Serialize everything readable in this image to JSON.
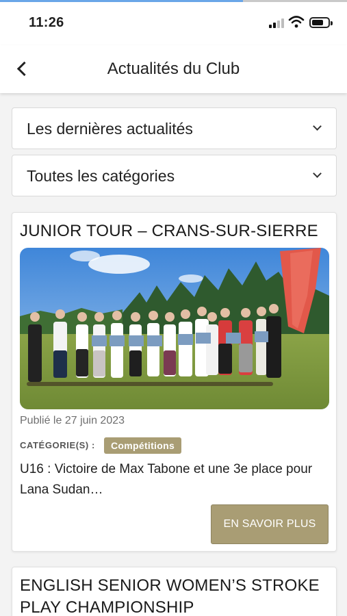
{
  "status_bar": {
    "time": "11:26",
    "icons": [
      "cellular-signal-icon",
      "wifi-icon",
      "battery-icon"
    ]
  },
  "header": {
    "back_icon": "chevron-left-icon",
    "title": "Actualités du Club"
  },
  "filters": {
    "sort": {
      "selected": "Les dernières actualités",
      "icon": "chevron-down-icon"
    },
    "category": {
      "selected": "Toutes les catégories",
      "icon": "chevron-down-icon"
    }
  },
  "articles": [
    {
      "title": "JUNIOR TOUR – CRANS-SUR-SIERRE",
      "published": "Publié le 27 juin 2023",
      "categories_label": "CATÉGORIE(S) :",
      "category": "Compétitions",
      "excerpt": "U16 : Victoire de Max Tabone et une 3e place pour Lana Sudan…",
      "button": "EN SAVOIR PLUS"
    },
    {
      "title": "ENGLISH SENIOR WOMEN’S STROKE PLAY CHAMPIONSHIP"
    }
  ],
  "colors": {
    "accent": "#a99d74",
    "background": "#f3f3f3",
    "card": "#ffffff"
  }
}
